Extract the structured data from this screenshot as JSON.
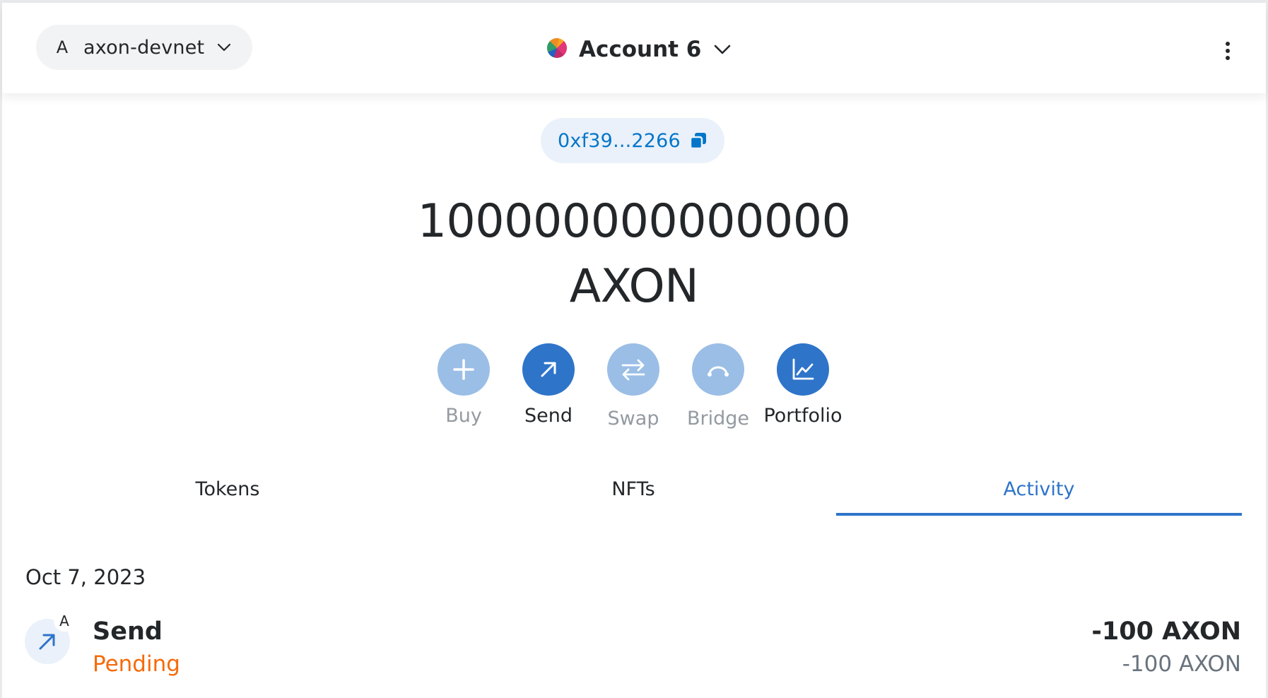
{
  "header": {
    "network": {
      "avatar_letter": "A",
      "label": "axon-devnet"
    },
    "account": {
      "name": "Account 6"
    }
  },
  "address": {
    "short": "0xf39...2266"
  },
  "balance": {
    "amount": "100000000000000",
    "symbol": "AXON"
  },
  "actions": [
    {
      "label": "Buy",
      "icon": "plus-icon",
      "enabled": false
    },
    {
      "label": "Send",
      "icon": "arrow-up-right-icon",
      "enabled": true
    },
    {
      "label": "Swap",
      "icon": "swap-arrows-icon",
      "enabled": false
    },
    {
      "label": "Bridge",
      "icon": "bridge-icon",
      "enabled": false
    },
    {
      "label": "Portfolio",
      "icon": "chart-icon",
      "enabled": true
    }
  ],
  "tabs": [
    {
      "label": "Tokens",
      "active": false
    },
    {
      "label": "NFTs",
      "active": false
    },
    {
      "label": "Activity",
      "active": true
    }
  ],
  "activity": {
    "date": "Oct 7, 2023",
    "items": [
      {
        "badge_letter": "A",
        "title": "Send",
        "status": "Pending",
        "amount": "-100 AXON",
        "fiat": "-100 AXON"
      }
    ]
  },
  "colors": {
    "primary": "#2e74c9",
    "primary_disabled": "#9bbee6",
    "pending": "#f66a0a",
    "address_bg": "#eaf1fa"
  }
}
